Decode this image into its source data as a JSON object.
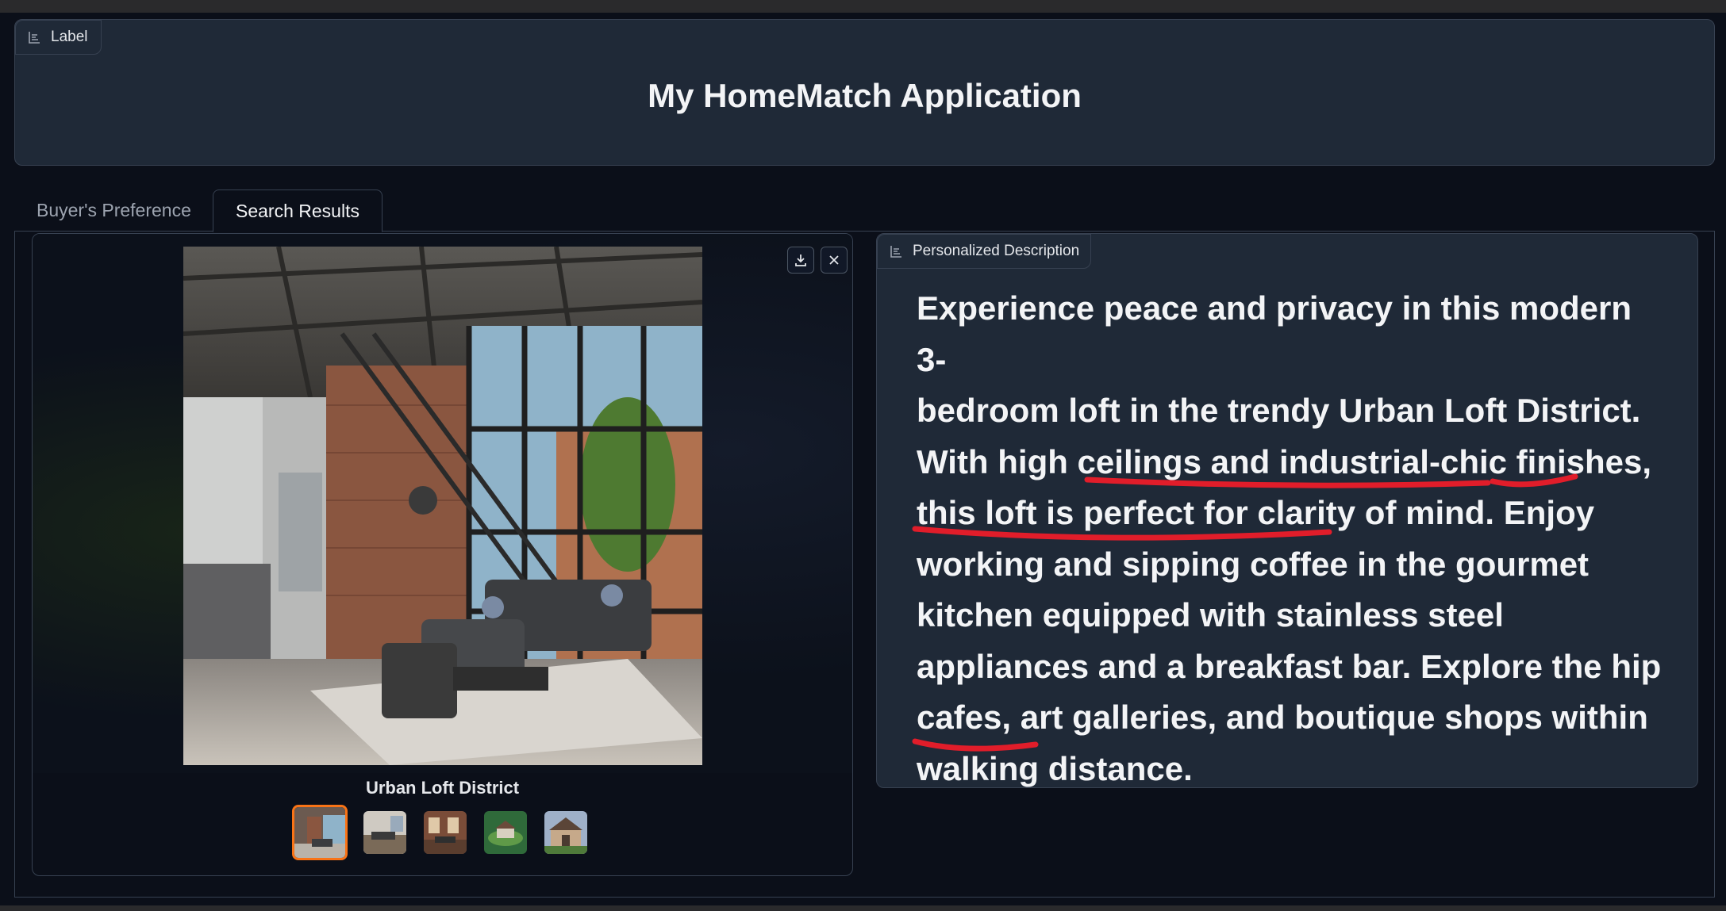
{
  "header": {
    "label_chip": "Label",
    "title": "My HomeMatch Application"
  },
  "tabs": [
    {
      "label": "Buyer's Preference",
      "active": false
    },
    {
      "label": "Search Results",
      "active": true
    }
  ],
  "gallery": {
    "caption": "Urban Loft District",
    "selected_index": 0,
    "thumbnail_count": 5,
    "download_icon": "download-icon",
    "close_icon": "close-icon"
  },
  "description": {
    "chip_label": "Personalized Description",
    "lines": [
      "Experience peace and privacy in this modern 3-",
      "bedroom loft in the trendy Urban Loft District.",
      "With high ceilings and industrial-chic finishes,",
      "this loft is perfect for clarity of mind. Enjoy",
      "working and sipping coffee in the gourmet",
      "kitchen equipped with stainless steel",
      "appliances and a breakfast bar. Explore the hip",
      "cafes, art galleries, and boutique shops within",
      "walking distance."
    ]
  },
  "colors": {
    "background": "#0b0f19",
    "panel": "#1f2937",
    "border": "#374151",
    "selected_thumb": "#f97316",
    "annotation": "#e11d2a"
  }
}
